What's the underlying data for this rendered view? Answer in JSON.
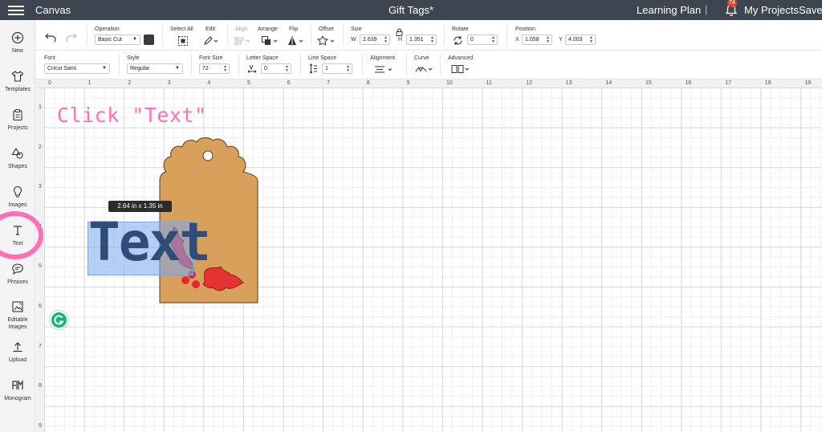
{
  "topbar": {
    "app_name": "Canvas",
    "document_title": "Gift Tags*",
    "learning_plan": "Learning Plan",
    "notifications_count": "74",
    "my_projects": "My Projects",
    "save": "Save",
    "separator": "|"
  },
  "sidebar": {
    "items": [
      {
        "label": "New",
        "icon": "plus-circle-icon"
      },
      {
        "label": "Templates",
        "icon": "shirt-icon"
      },
      {
        "label": "Projects",
        "icon": "clipboard-icon"
      },
      {
        "label": "Shapes",
        "icon": "shapes-icon"
      },
      {
        "label": "Images",
        "icon": "lightbulb-icon"
      },
      {
        "label": "Text",
        "icon": "text-t-icon"
      },
      {
        "label": "Phrases",
        "icon": "speech-bubble-icon"
      },
      {
        "label": "Editable",
        "label2": "Images",
        "icon": "edit-image-icon"
      },
      {
        "label": "Upload",
        "icon": "upload-icon"
      },
      {
        "label": "Monogram",
        "icon": "monogram-icon"
      }
    ]
  },
  "toolbar1": {
    "operation_label": "Operation",
    "operation_value": "Basic Cut",
    "operation_color": "#3b3b3b",
    "select_all_label": "Select All",
    "edit_label": "Edit",
    "align_label": "Align",
    "arrange_label": "Arrange",
    "flip_label": "Flip",
    "offset_label": "Offset",
    "size_label": "Size",
    "w_label": "W",
    "w_value": "2.639",
    "h_label": "H",
    "h_value": "1.351",
    "rotate_label": "Rotate",
    "rotate_value": "0",
    "position_label": "Position",
    "x_label": "X",
    "x_value": "1.058",
    "y_label": "Y",
    "y_value": "4.003"
  },
  "toolbar2": {
    "font_label": "Font",
    "font_value": "Cricut Sans",
    "style_label": "Style",
    "style_value": "Regular",
    "font_size_label": "Font Size",
    "font_size_value": "72",
    "letter_space_label": "Letter Space",
    "letter_space_value": "0",
    "line_space_label": "Line Space",
    "line_space_value": "1",
    "alignment_label": "Alignment",
    "curve_label": "Curve",
    "advanced_label": "Advanced"
  },
  "rulers": {
    "horizontal": [
      "0",
      "1",
      "2",
      "3",
      "4",
      "5",
      "6",
      "7",
      "8",
      "9",
      "10",
      "11",
      "12",
      "13",
      "14",
      "15",
      "16",
      "17",
      "18",
      "19"
    ],
    "vertical": [
      "1",
      "2",
      "3",
      "4",
      "5",
      "6",
      "7",
      "8",
      "9"
    ]
  },
  "canvas": {
    "instruction": "Click \"Text\"",
    "size_tooltip": "2.64  in x 1.35  in",
    "text_object": "Text",
    "colors": {
      "tag": "#d9a05b",
      "holly_leaf": "#e5332f",
      "berry": "#e8262f",
      "text_fill": "#2f4d78",
      "selection": "#78aaf0",
      "highlight_ring": "#ff6fb3",
      "grammarly": "#15b57b"
    }
  }
}
